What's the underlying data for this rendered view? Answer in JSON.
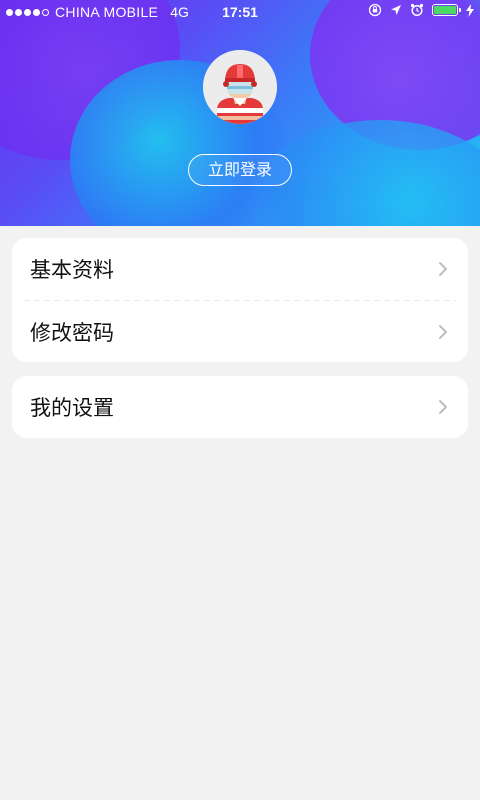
{
  "status_bar": {
    "carrier": "CHINA MOBILE",
    "network": "4G",
    "time": "17:51",
    "battery_color": "#4cd964"
  },
  "profile": {
    "avatar_icon": "hockey-player-avatar-icon",
    "login_label": "立即登录"
  },
  "menu": {
    "group1": [
      {
        "label": "基本资料",
        "icon": "chevron-right-icon"
      },
      {
        "label": "修改密码",
        "icon": "chevron-right-icon"
      }
    ],
    "group2": [
      {
        "label": "我的设置",
        "icon": "chevron-right-icon"
      }
    ]
  },
  "colors": {
    "header_gradient_start": "#6a2cf0",
    "header_gradient_end": "#21c7f3",
    "background": "#f2f2f2",
    "card": "#ffffff"
  }
}
